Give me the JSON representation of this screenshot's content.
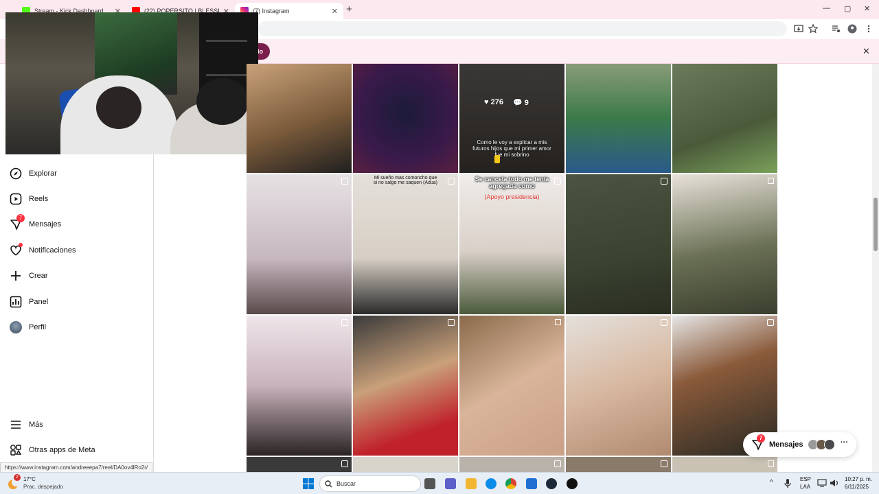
{
  "browser": {
    "tabs": [
      {
        "label": "Stream - Kick Dashboard",
        "favicon_color": "#53fc18"
      },
      {
        "label": "(22) POPERSITO | BLESSD ❌ KI",
        "favicon_color": "#ff0000"
      },
      {
        "label": "(7) Instagram",
        "favicon_color": "#c13584"
      }
    ],
    "new_tab_label": "+",
    "window_controls": {
      "minimize": "—",
      "maximize": "▢",
      "close": "✕"
    },
    "infobar_button": "do",
    "infobar_close": "✕"
  },
  "sidebar": {
    "items": [
      {
        "label": "Explorar",
        "icon": "compass-icon"
      },
      {
        "label": "Reels",
        "icon": "reels-icon"
      },
      {
        "label": "Mensajes",
        "icon": "messenger-icon",
        "badge": "7"
      },
      {
        "label": "Notificaciones",
        "icon": "heart-icon",
        "dot": true
      },
      {
        "label": "Crear",
        "icon": "plus-icon"
      },
      {
        "label": "Panel",
        "icon": "chart-icon"
      },
      {
        "label": "Perfil",
        "icon": "avatar-icon"
      }
    ],
    "bottom_items": [
      {
        "label": "Más",
        "icon": "menu-icon"
      },
      {
        "label": "Otras apps de Meta",
        "icon": "meta-apps-icon"
      }
    ]
  },
  "status_url": "https://www.instagram.com/andreeepa7/reel/DA0ov4lRo2r/",
  "grid": {
    "hovered": {
      "likes": "276",
      "comments": "9",
      "caption": "Como le voy a explicar a mis futuros hijos que mi primer amor fue mi sobrino"
    },
    "captions": {
      "t2_1": "Mi sueño mas comoncho que si no salgo me saquen (Adua)",
      "t2_2a": "Se cancela todo me tenía agregada como",
      "t2_2b": "(Apoyo presidencia)"
    }
  },
  "messages_pill": {
    "label": "Mensajes",
    "badge": "7",
    "more": "···"
  },
  "taskbar": {
    "weather_temp": "17°C",
    "weather_desc": "Prac. despejado",
    "weather_badge": "2",
    "search_placeholder": "Buscar",
    "lang_line1": "ESP",
    "lang_line2": "LAA",
    "time": "10:27 p. m.",
    "date": "6/11/2025"
  },
  "colors": {
    "accent": "#ff3040",
    "infobar_btn": "#7a1f4b",
    "tabbar": "#fce8ef"
  }
}
